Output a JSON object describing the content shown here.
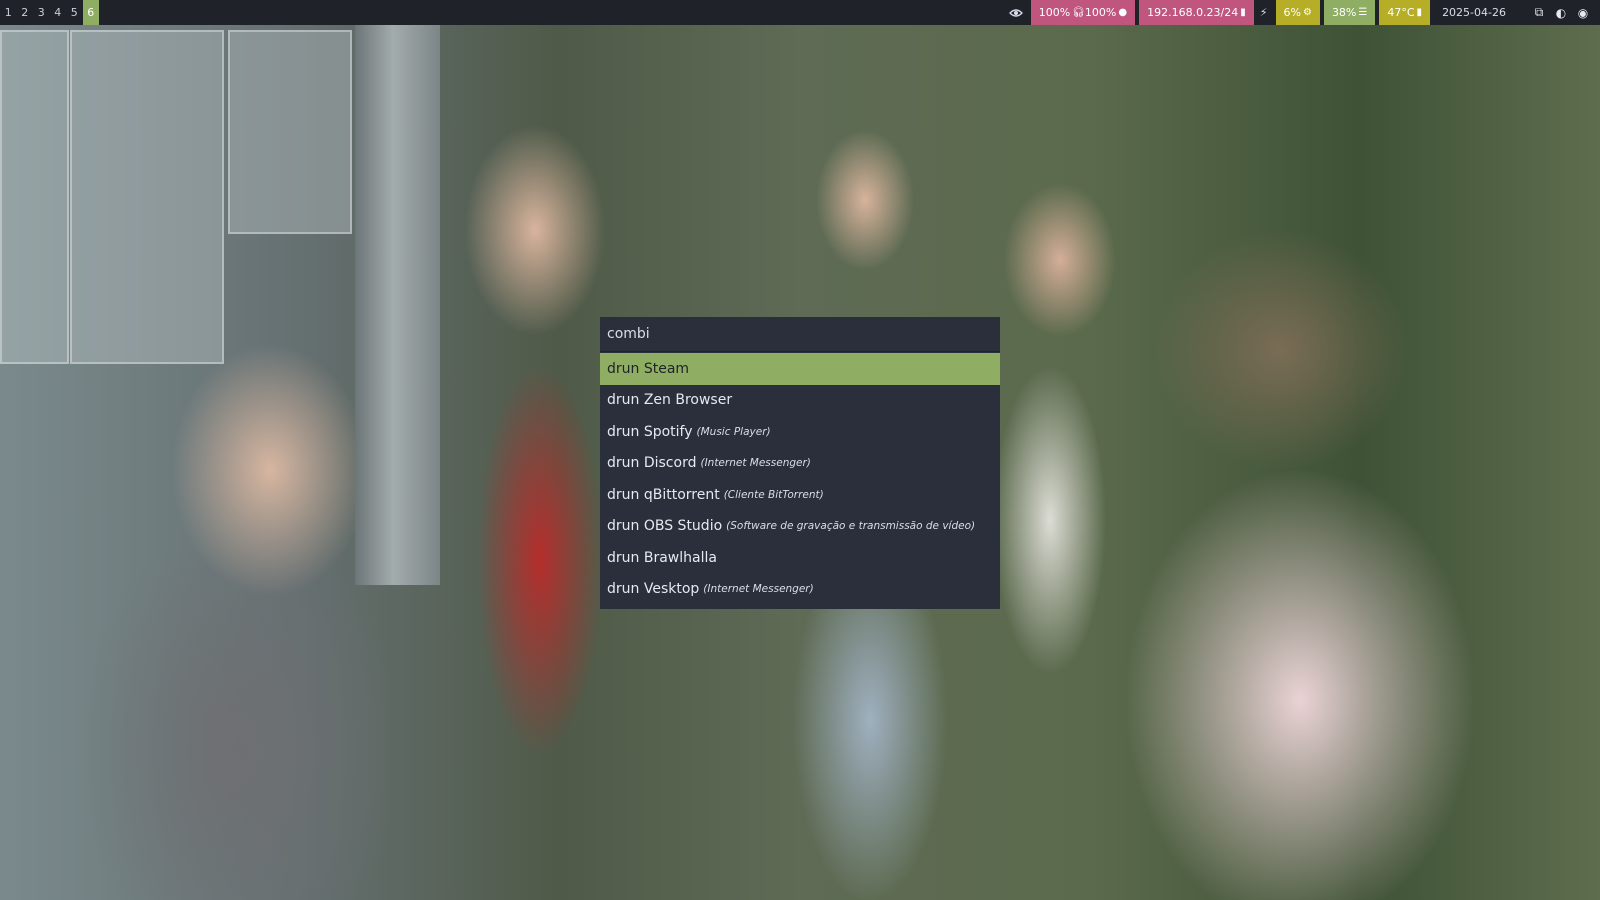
{
  "topbar": {
    "workspaces": [
      "1",
      "2",
      "3",
      "4",
      "5",
      "6"
    ],
    "active_workspace": "6",
    "icons": {
      "privacy": "eye-icon",
      "headphones": "headphones-icon",
      "microphone": "microphone-icon",
      "network": "ethernet-icon",
      "power": "lightning-icon",
      "cpu": "cpu-icon",
      "memory": "memory-icon",
      "temperature": "thermometer-icon",
      "tray1": "window-icon",
      "tray2": "steam-icon",
      "tray3": "discord-icon"
    },
    "volume": "100%",
    "mic": "100%",
    "network": "192.168.0.23/24",
    "cpu": "6%",
    "memory": "38%",
    "temperature": "47°C",
    "date": "2025-04-26"
  },
  "colors": {
    "bar_bg": "#1f2229",
    "accent_green": "#8fae63",
    "accent_pink": "#c0567e",
    "accent_yellow": "#b7ae28",
    "menu_bg": "#2a2f3b"
  },
  "menu": {
    "prompt": "combi",
    "items": [
      {
        "label": "drun Steam",
        "sub": ""
      },
      {
        "label": "drun Zen Browser",
        "sub": ""
      },
      {
        "label": "drun Spotify",
        "sub": "(Music Player)"
      },
      {
        "label": "drun Discord",
        "sub": "(Internet Messenger)"
      },
      {
        "label": "drun qBittorrent",
        "sub": "(Cliente BitTorrent)"
      },
      {
        "label": "drun OBS Studio",
        "sub": "(Software de gravação e transmissão de vídeo)"
      },
      {
        "label": "drun Brawlhalla",
        "sub": ""
      },
      {
        "label": "drun Vesktop",
        "sub": "(Internet Messenger)"
      }
    ],
    "selected_index": 0
  }
}
